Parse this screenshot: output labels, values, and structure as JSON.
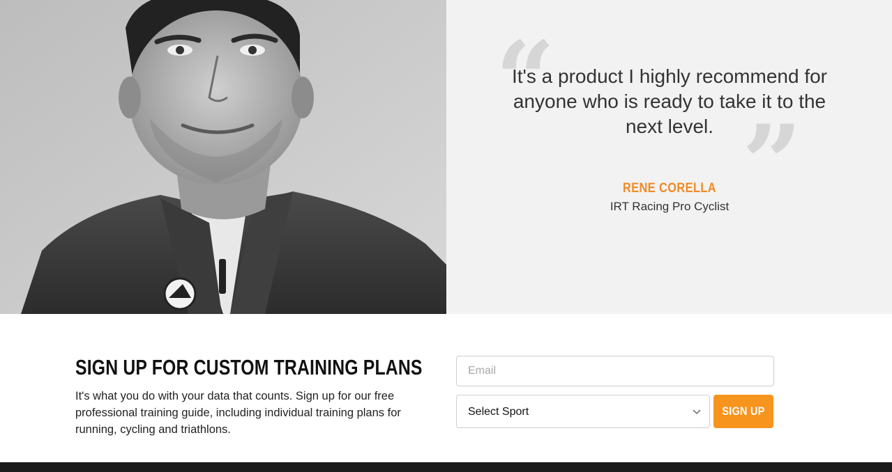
{
  "testimonial": {
    "quote": "It's a product I highly recommend for anyone who is ready to take it to the next level.",
    "author_name": "RENE CORELLA",
    "author_title": "IRT Racing Pro Cyclist",
    "open_mark": "“",
    "close_mark": "”",
    "photo_icon": "portrait-photo"
  },
  "signup": {
    "heading": "SIGN UP FOR CUSTOM TRAINING PLANS",
    "description": "It's what you do with your data that counts. Sign up for our free professional training guide, including individual training plans for running, cycling and triathlons.",
    "email_placeholder": "Email",
    "sport_select_value": "Select Sport",
    "button_label": "SIGN UP"
  },
  "colors": {
    "accent": "#f7941d",
    "author_accent": "#f08a24",
    "testimonial_bg": "#f2f2f2",
    "footer_bg": "#1b1b1b"
  }
}
